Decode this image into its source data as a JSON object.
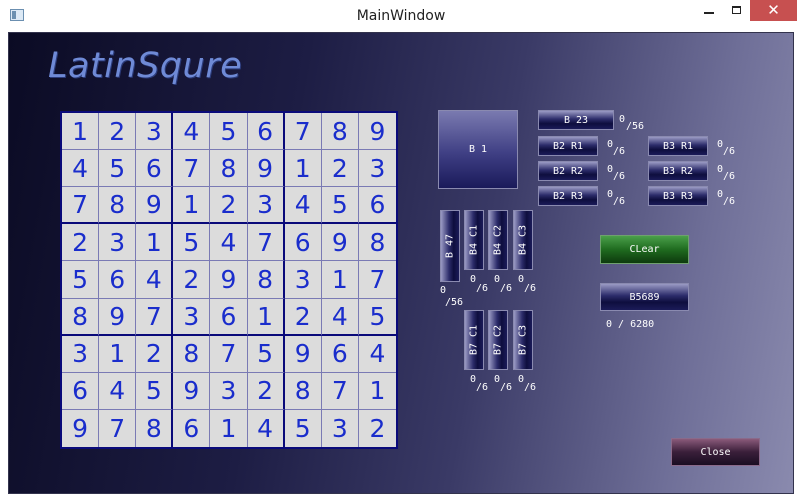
{
  "window": {
    "title": "MainWindow",
    "minimize": "",
    "maximize": "",
    "close": "✕"
  },
  "logo": "LatinSqure",
  "grid": [
    [
      "1",
      "2",
      "3",
      "4",
      "5",
      "6",
      "7",
      "8",
      "9"
    ],
    [
      "4",
      "5",
      "6",
      "7",
      "8",
      "9",
      "1",
      "2",
      "3"
    ],
    [
      "7",
      "8",
      "9",
      "1",
      "2",
      "3",
      "4",
      "5",
      "6"
    ],
    [
      "2",
      "3",
      "1",
      "5",
      "4",
      "7",
      "6",
      "9",
      "8"
    ],
    [
      "5",
      "6",
      "4",
      "2",
      "9",
      "8",
      "3",
      "1",
      "7"
    ],
    [
      "8",
      "9",
      "7",
      "3",
      "6",
      "1",
      "2",
      "4",
      "5"
    ],
    [
      "3",
      "1",
      "2",
      "8",
      "7",
      "5",
      "9",
      "6",
      "4"
    ],
    [
      "6",
      "4",
      "5",
      "9",
      "3",
      "2",
      "8",
      "7",
      "1"
    ],
    [
      "9",
      "7",
      "8",
      "6",
      "1",
      "4",
      "5",
      "3",
      "2"
    ]
  ],
  "buttons": {
    "b1": "B 1",
    "b23": "B 23",
    "b2r1": "B2 R1",
    "b2r2": "B2 R2",
    "b2r3": "B2 R3",
    "b3r1": "B3 R1",
    "b3r2": "B3 R2",
    "b3r3": "B3 R3",
    "b47": "B 47",
    "b4c1": "B4 C1",
    "b4c2": "B4 C2",
    "b4c3": "B4 C3",
    "b7c1": "B7 C1",
    "b7c2": "B7 C2",
    "b7c3": "B7 C3",
    "clear": "CLear",
    "b5689": "B5689",
    "close": "Close"
  },
  "scores": {
    "b23_num": "0",
    "b23_den": "/56",
    "b2r1_num": "0",
    "b2r1_den": "/6",
    "b2r2_num": "0",
    "b2r2_den": "/6",
    "b2r3_num": "0",
    "b2r3_den": "/6",
    "b3r1_num": "0",
    "b3r1_den": "/6",
    "b3r2_num": "0",
    "b3r2_den": "/6",
    "b3r3_num": "0",
    "b3r3_den": "/6",
    "b47_num": "0",
    "b47_den": "/56",
    "b4c1_num": "0",
    "b4c1_den": "/6",
    "b4c2_num": "0",
    "b4c2_den": "/6",
    "b4c3_num": "0",
    "b4c3_den": "/6",
    "b7c1_num": "0",
    "b7c1_den": "/6",
    "b7c2_num": "0",
    "b7c2_den": "/6",
    "b7c3_num": "0",
    "b7c3_den": "/6",
    "b5689": "0 / 6280"
  }
}
